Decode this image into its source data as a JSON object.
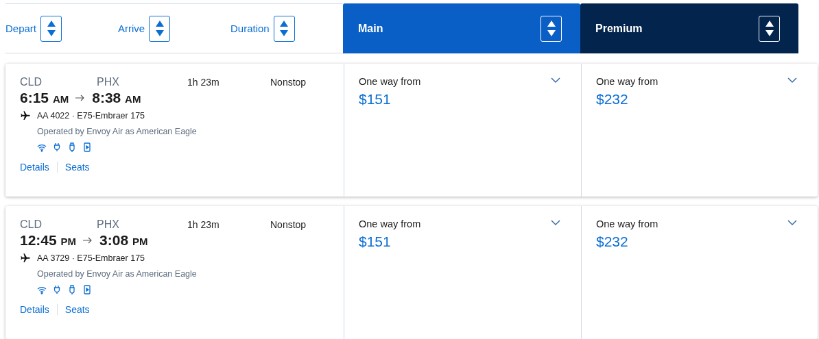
{
  "sort_options": [
    {
      "label": "Depart"
    },
    {
      "label": "Arrive"
    },
    {
      "label": "Duration"
    }
  ],
  "cabins": [
    {
      "name": "Main",
      "kind": "main"
    },
    {
      "name": "Premium",
      "kind": "premium"
    }
  ],
  "flights": [
    {
      "origin": "CLD",
      "destination": "PHX",
      "duration": "1h 23m",
      "stops": "Nonstop",
      "depart_time": "6:15",
      "depart_period": "AM",
      "arrive_time": "8:38",
      "arrive_period": "AM",
      "flight": "AA 4022 · E75-Embraer 175",
      "operator": "Operated by Envoy Air as American Eagle",
      "links": [
        "Details",
        "Seats"
      ],
      "fares": [
        {
          "label": "One way from",
          "price": "$151"
        },
        {
          "label": "One way from",
          "price": "$232"
        }
      ]
    },
    {
      "origin": "CLD",
      "destination": "PHX",
      "duration": "1h 23m",
      "stops": "Nonstop",
      "depart_time": "12:45",
      "depart_period": "PM",
      "arrive_time": "3:08",
      "arrive_period": "PM",
      "flight": "AA 3729 · E75-Embraer 175",
      "operator": "Operated by Envoy Air as American Eagle",
      "links": [
        "Details",
        "Seats"
      ],
      "fares": [
        {
          "label": "One way from",
          "price": "$151"
        },
        {
          "label": "One way from",
          "price": "$232"
        }
      ]
    }
  ]
}
